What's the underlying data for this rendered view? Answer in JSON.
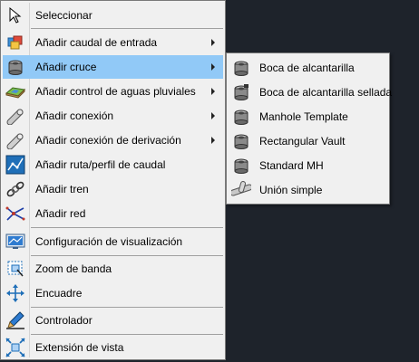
{
  "menu": {
    "items": [
      {
        "label": "Seleccionar"
      },
      {
        "label": "Añadir caudal de entrada"
      },
      {
        "label": "Añadir cruce"
      },
      {
        "label": "Añadir control de aguas pluviales"
      },
      {
        "label": "Añadir conexión"
      },
      {
        "label": "Añadir conexión de derivación"
      },
      {
        "label": "Añadir ruta/perfil de caudal"
      },
      {
        "label": "Añadir tren"
      },
      {
        "label": "Añadir red"
      },
      {
        "label": "Configuración de visualización"
      },
      {
        "label": "Zoom de banda"
      },
      {
        "label": "Encuadre"
      },
      {
        "label": "Controlador"
      },
      {
        "label": "Extensión de vista"
      }
    ]
  },
  "submenu": {
    "items": [
      {
        "label": "Boca de alcantarilla"
      },
      {
        "label": "Boca de alcantarilla sellada"
      },
      {
        "label": "Manhole Template"
      },
      {
        "label": "Rectangular Vault"
      },
      {
        "label": "Standard MH"
      },
      {
        "label": "Unión simple"
      }
    ]
  },
  "colors": {
    "highlight": "#91c9f7",
    "menu_bg": "#f0f0f0",
    "desktop_bg": "#1e232b"
  }
}
